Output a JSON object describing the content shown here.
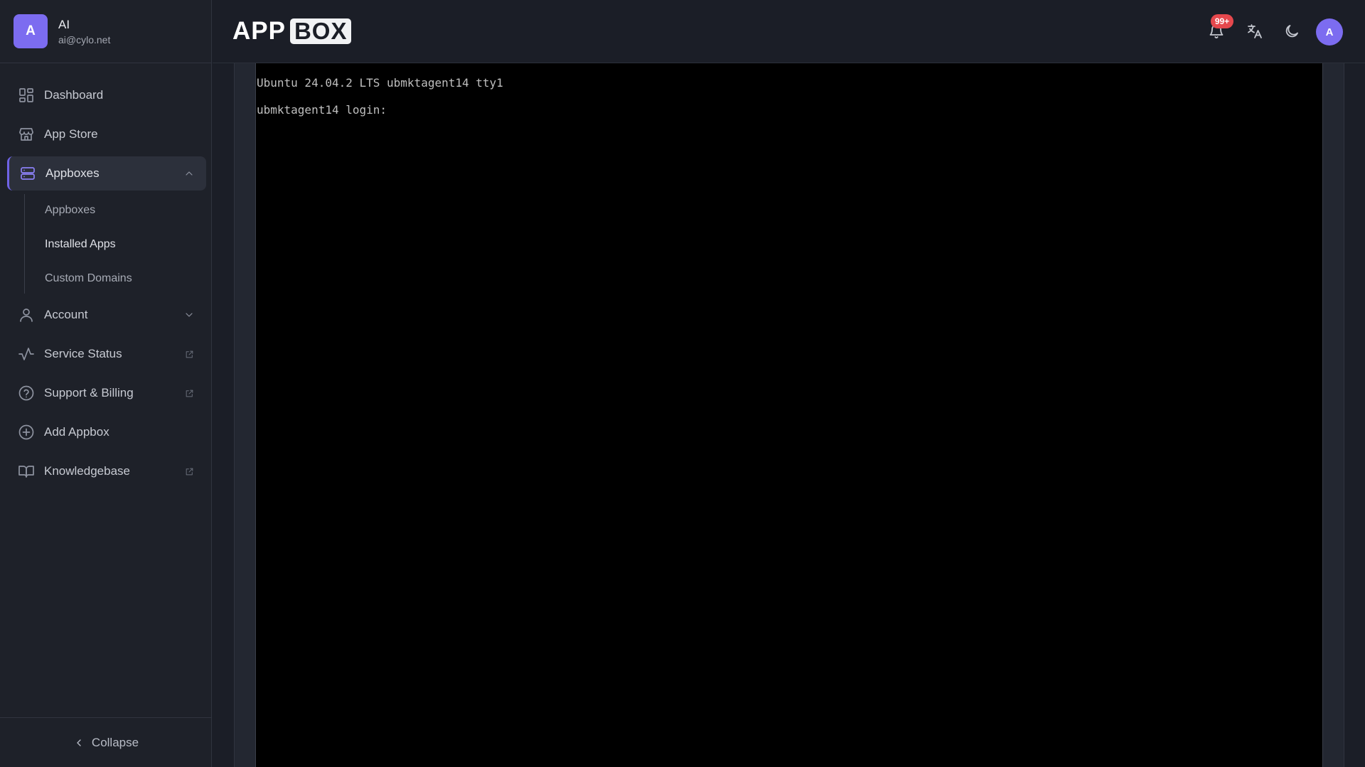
{
  "user": {
    "avatar_letter": "A",
    "name": "AI",
    "email": "ai@cylo.net"
  },
  "sidebar": {
    "items": [
      {
        "label": "Dashboard",
        "icon": "dashboard-grid-icon"
      },
      {
        "label": "App Store",
        "icon": "store-icon"
      },
      {
        "label": "Appboxes",
        "icon": "server-icon",
        "expanded": true,
        "active": true
      },
      {
        "label": "Account",
        "icon": "user-icon",
        "expanded": false
      },
      {
        "label": "Service Status",
        "icon": "activity-icon",
        "external": true
      },
      {
        "label": "Support & Billing",
        "icon": "help-circle-icon",
        "external": true
      },
      {
        "label": "Add Appbox",
        "icon": "plus-circle-icon"
      },
      {
        "label": "Knowledgebase",
        "icon": "book-icon",
        "external": true
      }
    ],
    "appboxes_sub": [
      "Appboxes",
      "Installed Apps",
      "Custom Domains"
    ],
    "current_sub": "Installed Apps",
    "collapse_label": "Collapse"
  },
  "header": {
    "logo_app": "APP",
    "logo_box": "BOX",
    "notification_badge": "99+",
    "avatar_letter": "A"
  },
  "terminal": {
    "lines": [
      "Ubuntu 24.04.2 LTS ubmktagent14 tty1",
      "ubmktagent14 login:"
    ]
  },
  "colors": {
    "accent": "#7c6cf0",
    "badge": "#e5484d",
    "terminal_bg": "#000000"
  }
}
